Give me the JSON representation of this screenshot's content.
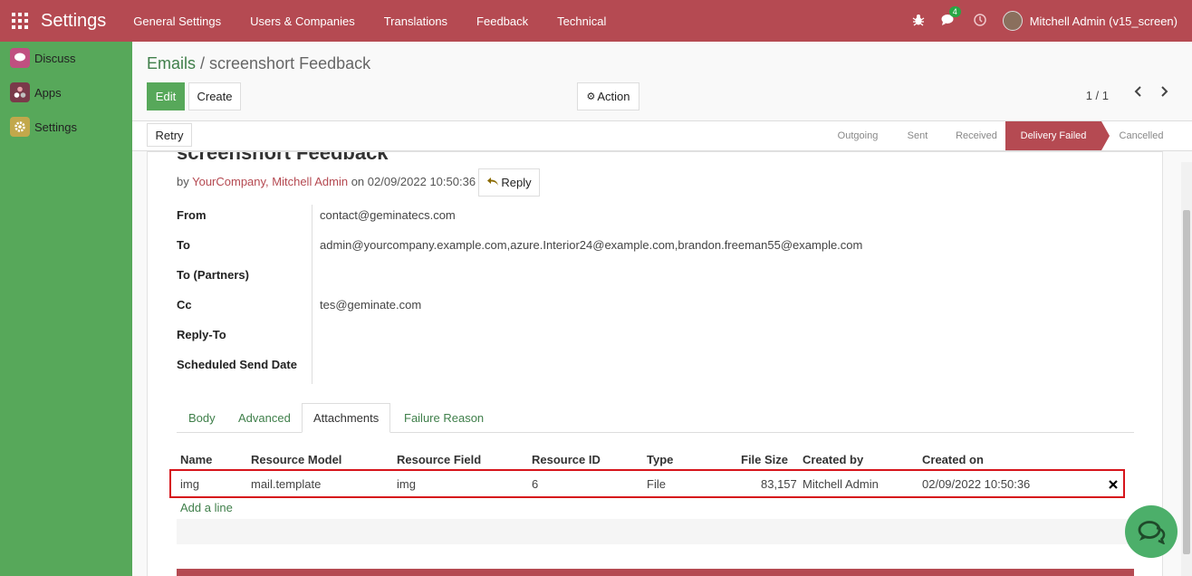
{
  "topbar": {
    "app_name": "Settings",
    "menu": [
      "General Settings",
      "Users & Companies",
      "Translations",
      "Feedback",
      "Technical"
    ],
    "chat_badge": "4",
    "user": "Mitchell Admin (v15_screen)"
  },
  "sidebar": {
    "items": [
      {
        "label": "Discuss",
        "icon": "discuss-icon",
        "color": "#c05080"
      },
      {
        "label": "Apps",
        "icon": "apps-icon",
        "color": "#7a3a4a"
      },
      {
        "label": "Settings",
        "icon": "gear-icon",
        "color": "#c2a84b"
      }
    ]
  },
  "breadcrumb": {
    "parent": "Emails",
    "separator": " / ",
    "current": "screenshort Feedback"
  },
  "toolbar": {
    "edit": "Edit",
    "create": "Create",
    "action": "Action",
    "pager": "1 / 1"
  },
  "statusbar": {
    "retry": "Retry",
    "stages": [
      "Outgoing",
      "Sent",
      "Received",
      "Delivery Failed",
      "Cancelled"
    ],
    "active_stage": "Delivery Failed"
  },
  "message": {
    "title": "screenshort Feedback",
    "by": "by ",
    "authors": "YourCompany, Mitchell Admin",
    "on": " on 02/09/2022 10:50:36",
    "reply": "Reply",
    "fields": [
      {
        "label": "From",
        "value": "contact@geminatecs.com"
      },
      {
        "label": "To",
        "value": "admin@yourcompany.example.com,azure.Interior24@example.com,brandon.freeman55@example.com"
      },
      {
        "label": "To (Partners)",
        "value": ""
      },
      {
        "label": "Cc",
        "value": "tes@geminate.com"
      },
      {
        "label": "Reply-To",
        "value": ""
      },
      {
        "label": "Scheduled Send Date",
        "value": ""
      }
    ]
  },
  "tabs": {
    "items": [
      "Body",
      "Advanced",
      "Attachments",
      "Failure Reason"
    ],
    "active": "Attachments"
  },
  "attachments": {
    "columns": [
      "Name",
      "Resource Model",
      "Resource Field",
      "Resource ID",
      "Type",
      "File Size",
      "Created by",
      "Created on"
    ],
    "rows": [
      [
        "img",
        "mail.template",
        "img",
        "6",
        "File",
        "83,157",
        "Mitchell Admin",
        "02/09/2022 10:50:36"
      ]
    ],
    "add_line": "Add a line"
  },
  "colors": {
    "brand": "#b54a52",
    "sidebar": "#57a85a",
    "link": "#3f7f4a",
    "highlight": "#d6141b"
  }
}
